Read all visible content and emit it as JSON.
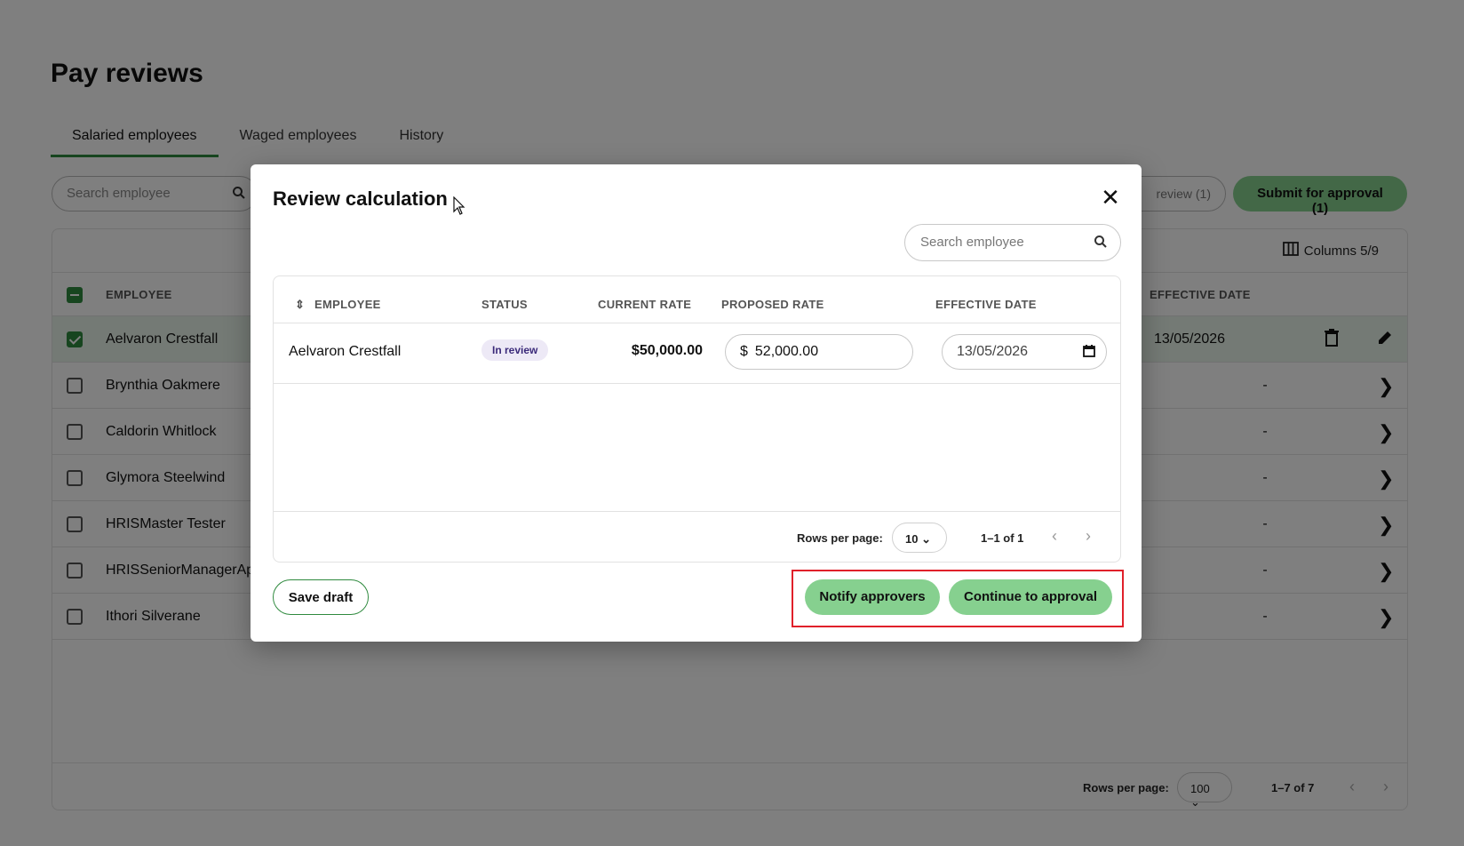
{
  "page": {
    "title": "Pay reviews",
    "tabs": [
      {
        "label": "Salaried employees",
        "active": true
      },
      {
        "label": "Waged employees",
        "active": false
      },
      {
        "label": "History",
        "active": false
      }
    ],
    "search_placeholder": "Search employee",
    "review_button_label": "review (1)",
    "submit_button_label": "Submit for approval (1)",
    "columns_label": "Columns 5/9",
    "table": {
      "header_employee": "EMPLOYEE",
      "header_effective_date": "EFFECTIVE DATE",
      "rows": [
        {
          "name": "Aelvaron Crestfall",
          "date": "13/05/2026",
          "selected": true
        },
        {
          "name": "Brynthia Oakmere",
          "date": "-",
          "selected": false
        },
        {
          "name": "Caldorin Whitlock",
          "date": "-",
          "selected": false
        },
        {
          "name": "Glymora Steelwind",
          "date": "-",
          "selected": false
        },
        {
          "name": "HRISMaster Tester",
          "date": "-",
          "selected": false
        },
        {
          "name": "HRISSeniorManagerAp",
          "date": "-",
          "selected": false
        },
        {
          "name": "Ithori Silverane",
          "date": "-",
          "selected": false
        }
      ],
      "rows_per_page_label": "Rows per page:",
      "rows_per_page_value": "100",
      "count_label": "1–7 of 7"
    }
  },
  "modal": {
    "title": "Review calculation",
    "search_placeholder": "Search employee",
    "headers": {
      "employee": "EMPLOYEE",
      "status": "STATUS",
      "current_rate": "CURRENT RATE",
      "proposed_rate": "PROPOSED RATE",
      "effective_date": "EFFECTIVE DATE"
    },
    "row": {
      "employee": "Aelvaron Crestfall",
      "status": "In review",
      "current_rate": "$50,000.00",
      "proposed_currency": "$",
      "proposed_rate": "52,000.00",
      "effective_date": "13/05/2026"
    },
    "rows_per_page_label": "Rows per page:",
    "rows_per_page_value": "10",
    "count_label": "1–1 of 1",
    "save_draft_label": "Save draft",
    "notify_label": "Notify approvers",
    "continue_label": "Continue to approval"
  },
  "colors": {
    "accent": "#2f8a3e",
    "button_green": "#86d08f",
    "highlight": "#e0202a",
    "badge_bg": "#ede9f6"
  }
}
